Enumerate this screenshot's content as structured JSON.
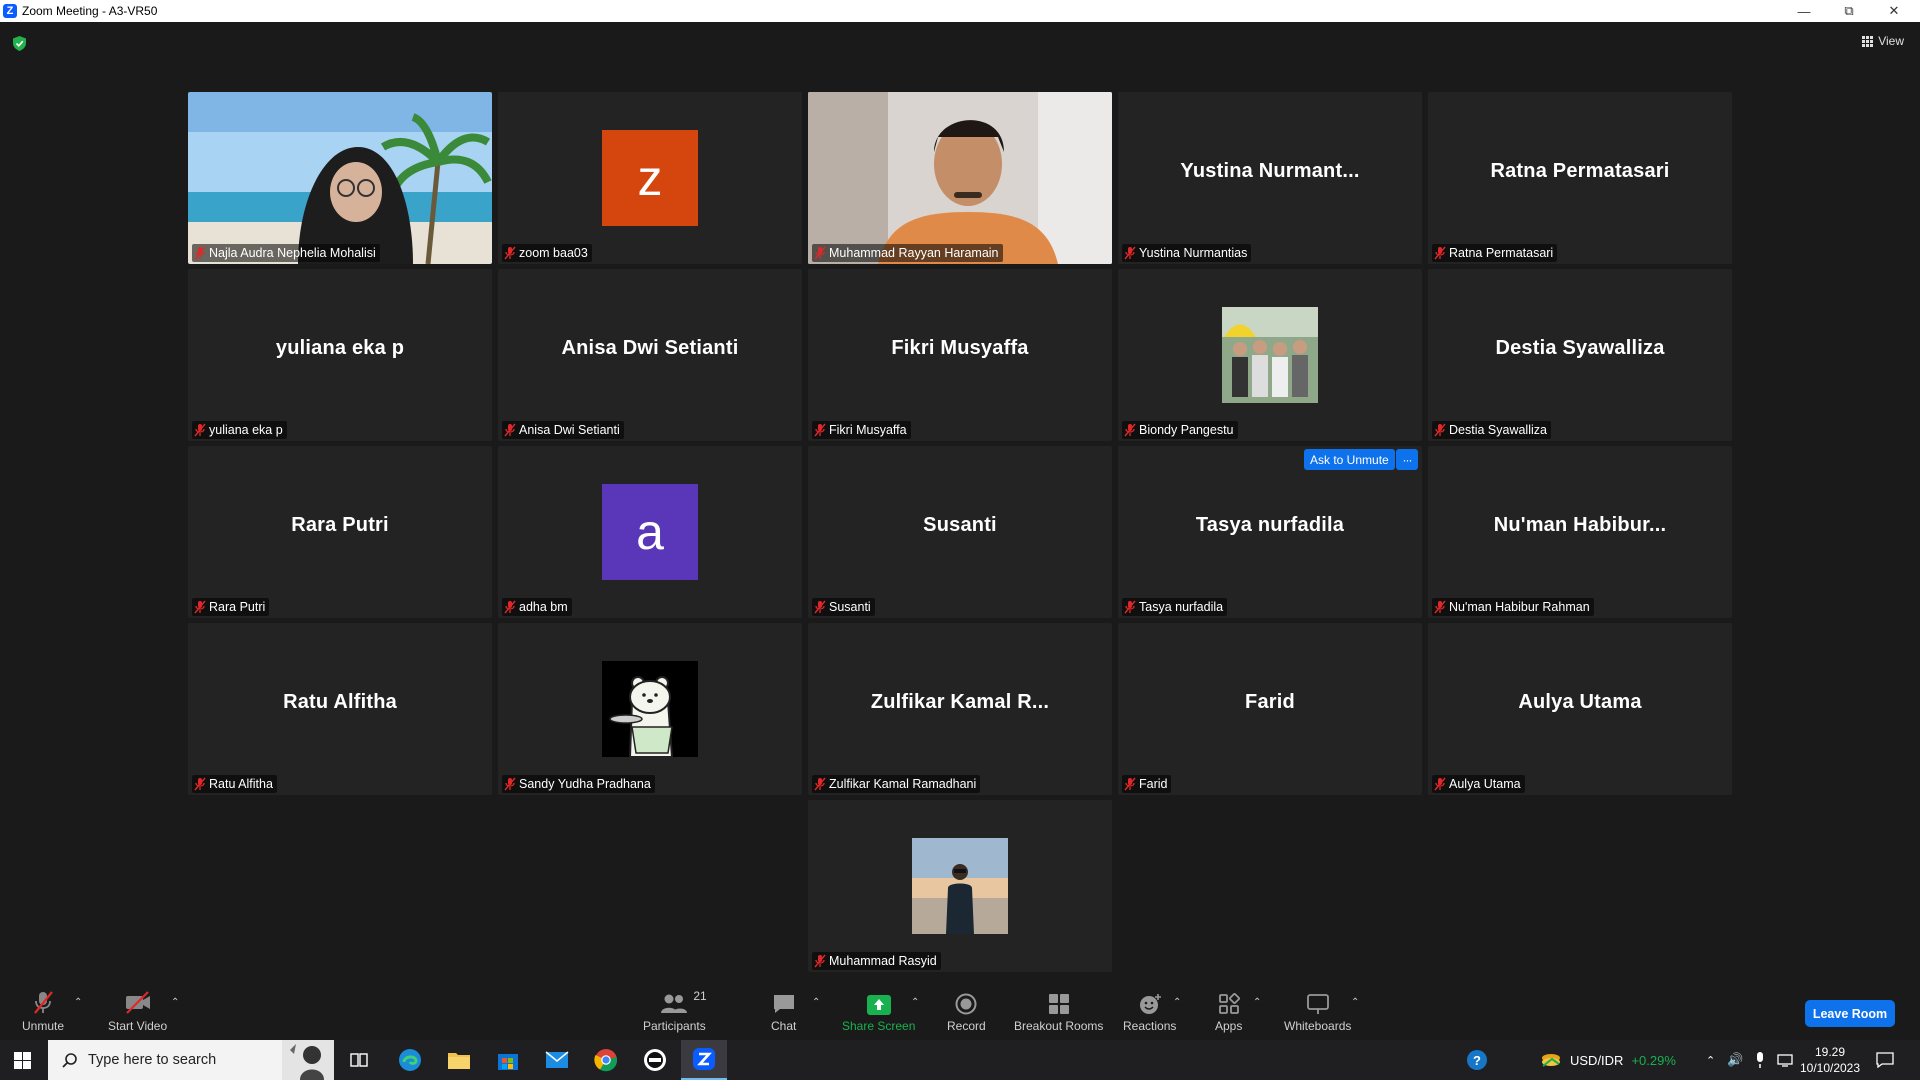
{
  "window": {
    "title": "Zoom Meeting - A3-VR50"
  },
  "view_button": {
    "label": "View"
  },
  "participants": [
    {
      "big": "",
      "label": "Najla Audra Nephelia Mohalisi",
      "type": "photo-beach"
    },
    {
      "big": "",
      "label": "zoom baa03",
      "type": "avatar",
      "letter": "z",
      "color": "#d4460e"
    },
    {
      "big": "",
      "label": "Muhammad Rayyan Haramain",
      "type": "photo-man",
      "active": true
    },
    {
      "big": "Yustina  Nurmant...",
      "label": "Yustina Nurmantias"
    },
    {
      "big": "Ratna Permatasari",
      "label": "Ratna Permatasari"
    },
    {
      "big": "yuliana eka p",
      "label": "yuliana eka p"
    },
    {
      "big": "Anisa Dwi Setianti",
      "label": "Anisa Dwi Setianti"
    },
    {
      "big": "Fikri Musyaffa",
      "label": "Fikri Musyaffa"
    },
    {
      "big": "",
      "label": "Biondy Pangestu",
      "type": "photo-group"
    },
    {
      "big": "Destia Syawalliza",
      "label": "Destia Syawalliza"
    },
    {
      "big": "Rara Putri",
      "label": "Rara Putri"
    },
    {
      "big": "",
      "label": "adha bm",
      "type": "avatar",
      "letter": "a",
      "color": "#5a36b8"
    },
    {
      "big": "Susanti",
      "label": "Susanti"
    },
    {
      "big": "Tasya nurfadila",
      "label": "Tasya nurfadila"
    },
    {
      "big": "Nu'man  Habibur...",
      "label": "Nu'man Habibur Rahman"
    },
    {
      "big": "Ratu Alfitha",
      "label": "Ratu Alfitha"
    },
    {
      "big": "",
      "label": "Sandy Yudha Pradhana",
      "type": "photo-bear"
    },
    {
      "big": "Zulfikar  Kamal  R...",
      "label": "Zulfikar Kamal Ramadhani"
    },
    {
      "big": "Farid",
      "label": "Farid"
    },
    {
      "big": "Aulya Utama",
      "label": "Aulya Utama"
    },
    {
      "big": "",
      "label": "Muhammad Rasyid",
      "type": "photo-sunset"
    }
  ],
  "hover": {
    "ask_to_unmute": "Ask to Unmute",
    "more": "···"
  },
  "toolbar": {
    "unmute": "Unmute",
    "start_video": "Start Video",
    "participants": "Participants",
    "participants_count": "21",
    "chat": "Chat",
    "share_screen": "Share Screen",
    "record": "Record",
    "breakout_rooms": "Breakout Rooms",
    "reactions": "Reactions",
    "apps": "Apps",
    "whiteboards": "Whiteboards",
    "leave": "Leave Room"
  },
  "taskbar": {
    "search_placeholder": "Type here to search",
    "currency_pair": "USD/IDR",
    "currency_change": "+0.29%",
    "time": "19.29",
    "date": "10/10/2023"
  },
  "colors": {
    "active_border": "#e2f46a",
    "accent": "#0e72ed",
    "share_green": "#19b14f",
    "muted_red": "#e02828"
  }
}
